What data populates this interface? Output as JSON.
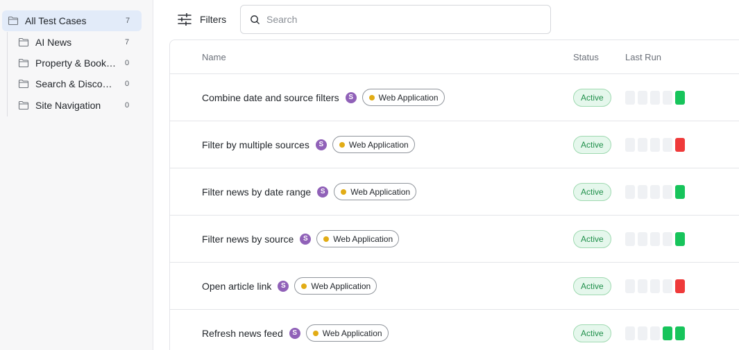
{
  "sidebar": {
    "root": {
      "label": "All Test Cases",
      "count": "7"
    },
    "folders": [
      {
        "label": "AI News",
        "count": "7"
      },
      {
        "label": "Property & Booking",
        "count": "0"
      },
      {
        "label": "Search & Discovery",
        "count": "0"
      },
      {
        "label": "Site Navigation",
        "count": "0"
      }
    ]
  },
  "toolbar": {
    "filters_label": "Filters",
    "search": {
      "placeholder": "Search",
      "value": ""
    }
  },
  "table": {
    "columns": {
      "name": "Name",
      "status": "Status",
      "last_run": "Last Run"
    },
    "rows": [
      {
        "name": "Combine date and source filters",
        "avatar": "S",
        "tag": "Web Application",
        "status": "Active",
        "runs": [
          "none",
          "none",
          "none",
          "none",
          "pass"
        ]
      },
      {
        "name": "Filter by multiple sources",
        "avatar": "S",
        "tag": "Web Application",
        "status": "Active",
        "runs": [
          "none",
          "none",
          "none",
          "none",
          "fail"
        ]
      },
      {
        "name": "Filter news by date range",
        "avatar": "S",
        "tag": "Web Application",
        "status": "Active",
        "runs": [
          "none",
          "none",
          "none",
          "none",
          "pass"
        ]
      },
      {
        "name": "Filter news by source",
        "avatar": "S",
        "tag": "Web Application",
        "status": "Active",
        "runs": [
          "none",
          "none",
          "none",
          "none",
          "pass"
        ]
      },
      {
        "name": "Open article link",
        "avatar": "S",
        "tag": "Web Application",
        "status": "Active",
        "runs": [
          "none",
          "none",
          "none",
          "none",
          "fail"
        ]
      },
      {
        "name": "Refresh news feed",
        "avatar": "S",
        "tag": "Web Application",
        "status": "Active",
        "runs": [
          "none",
          "none",
          "none",
          "pass",
          "pass"
        ]
      }
    ]
  },
  "colors": {
    "accent_selected": "#e2ebf9",
    "avatar": "#9061b8",
    "tag_dot": "#e2ac15",
    "status_active_bg": "#e5f7ec",
    "status_active_text": "#1f8f4a",
    "run_pass": "#17c45b",
    "run_fail": "#ef3a3a",
    "run_none": "#eff1f4"
  },
  "icons": {
    "folder": "folder-icon",
    "filters": "sliders-icon",
    "search": "search-icon"
  }
}
